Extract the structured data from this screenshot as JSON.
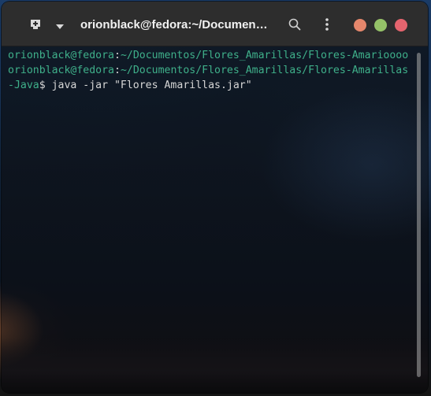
{
  "header": {
    "title": "orionblack@fedora:~/Documen…"
  },
  "icons": {
    "new_tab": "new-tab-icon",
    "dropdown": "chevron-down-icon",
    "search": "search-icon",
    "menu": "kebab-menu-icon"
  },
  "window_buttons": {
    "minimize_color": "#e5876c",
    "maximize_color": "#95c268",
    "close_color": "#e5646e"
  },
  "colors": {
    "prompt_green": "#3fb08a",
    "text": "#d6d6d6",
    "headerbar": "#2d2d2d"
  },
  "terminal": {
    "lines": [
      {
        "user_host": "orionblack@fedora",
        "sep": ":",
        "path": "~/Documentos/Flores_Amarillas/Flores-Amarioooo",
        "rest": ""
      },
      {
        "user_host": "orionblack@fedora",
        "sep": ":",
        "path": "~/Documentos/Flores_Amarillas/Flores-Amarillas",
        "rest": ""
      },
      {
        "user_host": "",
        "sep": "",
        "path": "-Java",
        "rest": "$ java -jar \"Flores Amarillas.jar\""
      }
    ]
  }
}
